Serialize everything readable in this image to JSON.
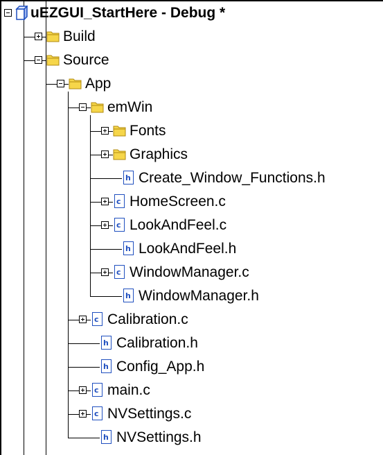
{
  "project": {
    "name": "uEZGUI_StartHere - Debug *"
  },
  "icons": {
    "folder": "folder-icon",
    "c_file": "c-source-file-icon",
    "h_file": "header-file-icon",
    "project": "project-icon",
    "expand": "expand-icon",
    "collapse": "collapse-icon"
  },
  "colors": {
    "folder_fill": "#f6d64a",
    "folder_outline": "#b08a10",
    "file_accent": "#1f4fbf"
  },
  "nodes": [
    {
      "label": "Build",
      "depth": 1,
      "type": "folder",
      "toggle": "plus"
    },
    {
      "label": "Source",
      "depth": 1,
      "type": "folder",
      "toggle": "minus"
    },
    {
      "label": "App",
      "depth": 2,
      "type": "folder",
      "toggle": "minus"
    },
    {
      "label": "emWin",
      "depth": 3,
      "type": "folder",
      "toggle": "minus"
    },
    {
      "label": "Fonts",
      "depth": 4,
      "type": "folder",
      "toggle": "plus"
    },
    {
      "label": "Graphics",
      "depth": 4,
      "type": "folder",
      "toggle": "plus"
    },
    {
      "label": "Create_Window_Functions.h",
      "depth": 4,
      "type": "h",
      "toggle": "none"
    },
    {
      "label": "HomeScreen.c",
      "depth": 4,
      "type": "c",
      "toggle": "plus"
    },
    {
      "label": "LookAndFeel.c",
      "depth": 4,
      "type": "c",
      "toggle": "plus"
    },
    {
      "label": "LookAndFeel.h",
      "depth": 4,
      "type": "h",
      "toggle": "none"
    },
    {
      "label": "WindowManager.c",
      "depth": 4,
      "type": "c",
      "toggle": "plus"
    },
    {
      "label": "WindowManager.h",
      "depth": 4,
      "type": "h",
      "toggle": "none"
    },
    {
      "label": "Calibration.c",
      "depth": 3,
      "type": "c",
      "toggle": "plus"
    },
    {
      "label": "Calibration.h",
      "depth": 3,
      "type": "h",
      "toggle": "none"
    },
    {
      "label": "Config_App.h",
      "depth": 3,
      "type": "h",
      "toggle": "none"
    },
    {
      "label": "main.c",
      "depth": 3,
      "type": "c",
      "toggle": "plus"
    },
    {
      "label": "NVSettings.c",
      "depth": 3,
      "type": "c",
      "toggle": "plus"
    },
    {
      "label": "NVSettings.h",
      "depth": 3,
      "type": "h",
      "toggle": "none"
    }
  ]
}
